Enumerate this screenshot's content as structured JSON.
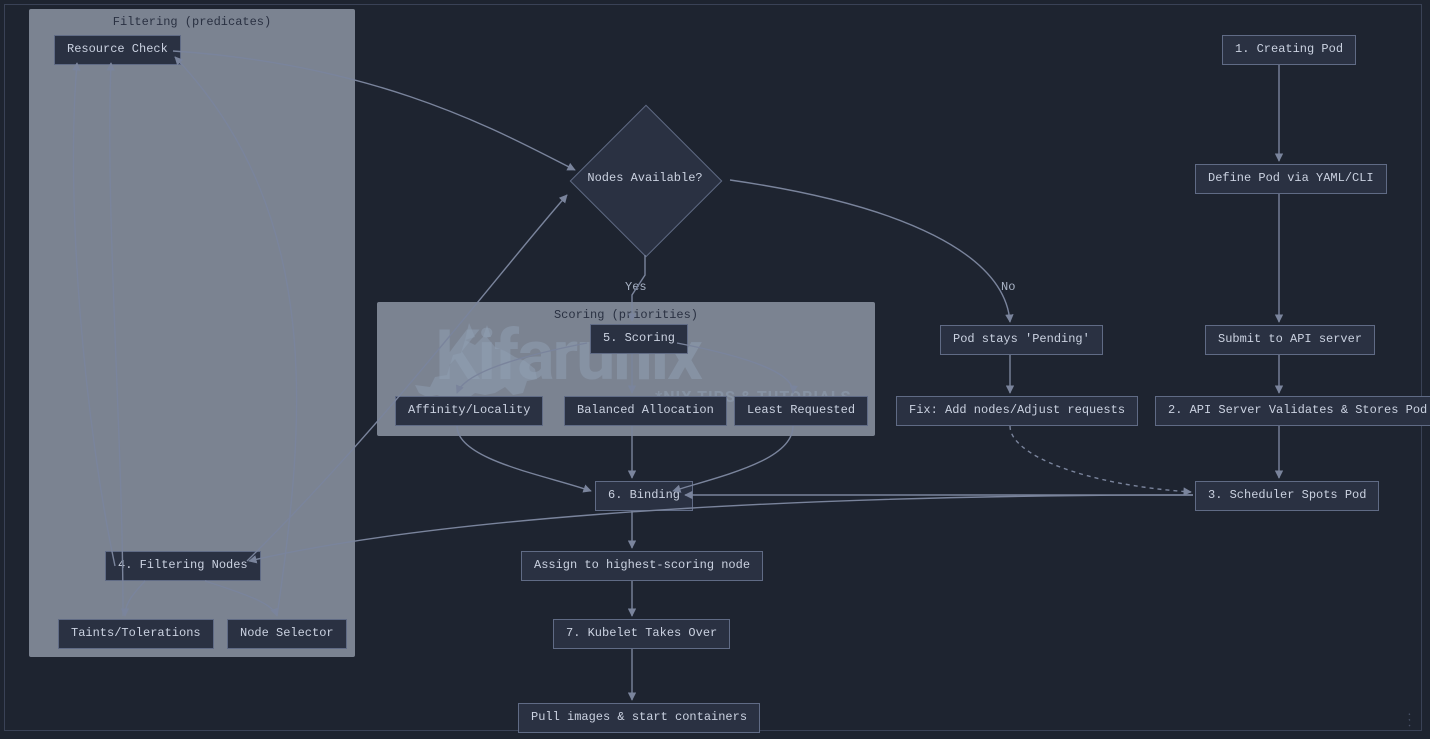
{
  "groups": {
    "filtering": {
      "title": "Filtering (predicates)"
    },
    "scoring": {
      "title": "Scoring (priorities)"
    }
  },
  "nodes": {
    "resource_check": "Resource Check",
    "creating_pod": "1. Creating Pod",
    "nodes_available": "Nodes Available?",
    "define_pod": "Define Pod via YAML/CLI",
    "scoring": "5. Scoring",
    "pod_pending": "Pod stays 'Pending'",
    "submit_api": "Submit to API server",
    "affinity": "Affinity/Locality",
    "balanced": "Balanced Allocation",
    "least_requested": "Least Requested",
    "fix_nodes": "Fix: Add nodes/Adjust requests",
    "api_validates": "2. API Server Validates & Stores Pod",
    "binding": "6. Binding",
    "scheduler": "3. Scheduler Spots Pod",
    "filtering_nodes": "4. Filtering Nodes",
    "assign": "Assign to highest-scoring node",
    "taints": "Taints/Tolerations",
    "node_selector": "Node Selector",
    "kubelet": "7. Kubelet Takes Over",
    "pull_images": "Pull images & start containers"
  },
  "edge_labels": {
    "yes": "Yes",
    "no": "No"
  },
  "watermark": {
    "brand": "Kifarunix",
    "tagline": "*NIX TIPS & TUTORIALS"
  }
}
